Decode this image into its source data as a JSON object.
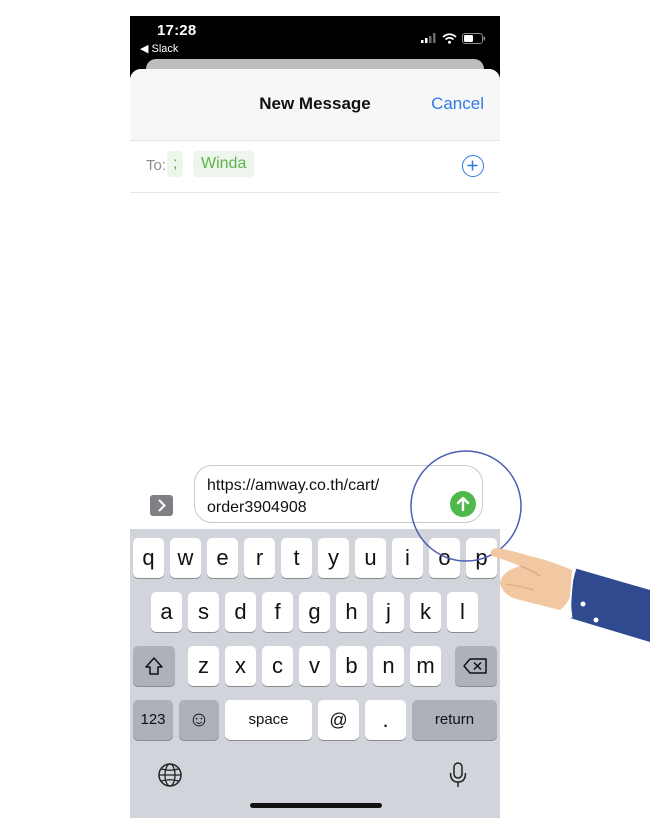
{
  "status_bar": {
    "time": "17:28",
    "back_app": "◀ Slack"
  },
  "nav": {
    "title": "New Message",
    "cancel_label": "Cancel"
  },
  "recipients": {
    "to_label": "To:",
    "separator": ";",
    "name": "Winda"
  },
  "compose": {
    "line1": "https://amway.co.th/cart/",
    "line2": "order3904908"
  },
  "keyboard": {
    "row1": [
      "q",
      "w",
      "e",
      "r",
      "t",
      "y",
      "u",
      "i",
      "o",
      "p"
    ],
    "row2": [
      "a",
      "s",
      "d",
      "f",
      "g",
      "h",
      "j",
      "k",
      "l"
    ],
    "row3": [
      "z",
      "x",
      "c",
      "v",
      "b",
      "n",
      "m"
    ],
    "numbers_label": "123",
    "emoji_label": "☺",
    "space_label": "space",
    "at_label": "@",
    "period_label": ".",
    "return_label": "return"
  },
  "icons": {
    "add_recipient": "plus-circle-icon",
    "send": "arrow-up-icon",
    "expand": "chevron-right-icon",
    "shift": "shift-icon",
    "delete": "backspace-icon",
    "globe": "globe-icon",
    "mic": "microphone-icon"
  },
  "colors": {
    "accent": "#2f7ae5",
    "recipient": "#5bb34a",
    "send": "#4fb84a"
  }
}
